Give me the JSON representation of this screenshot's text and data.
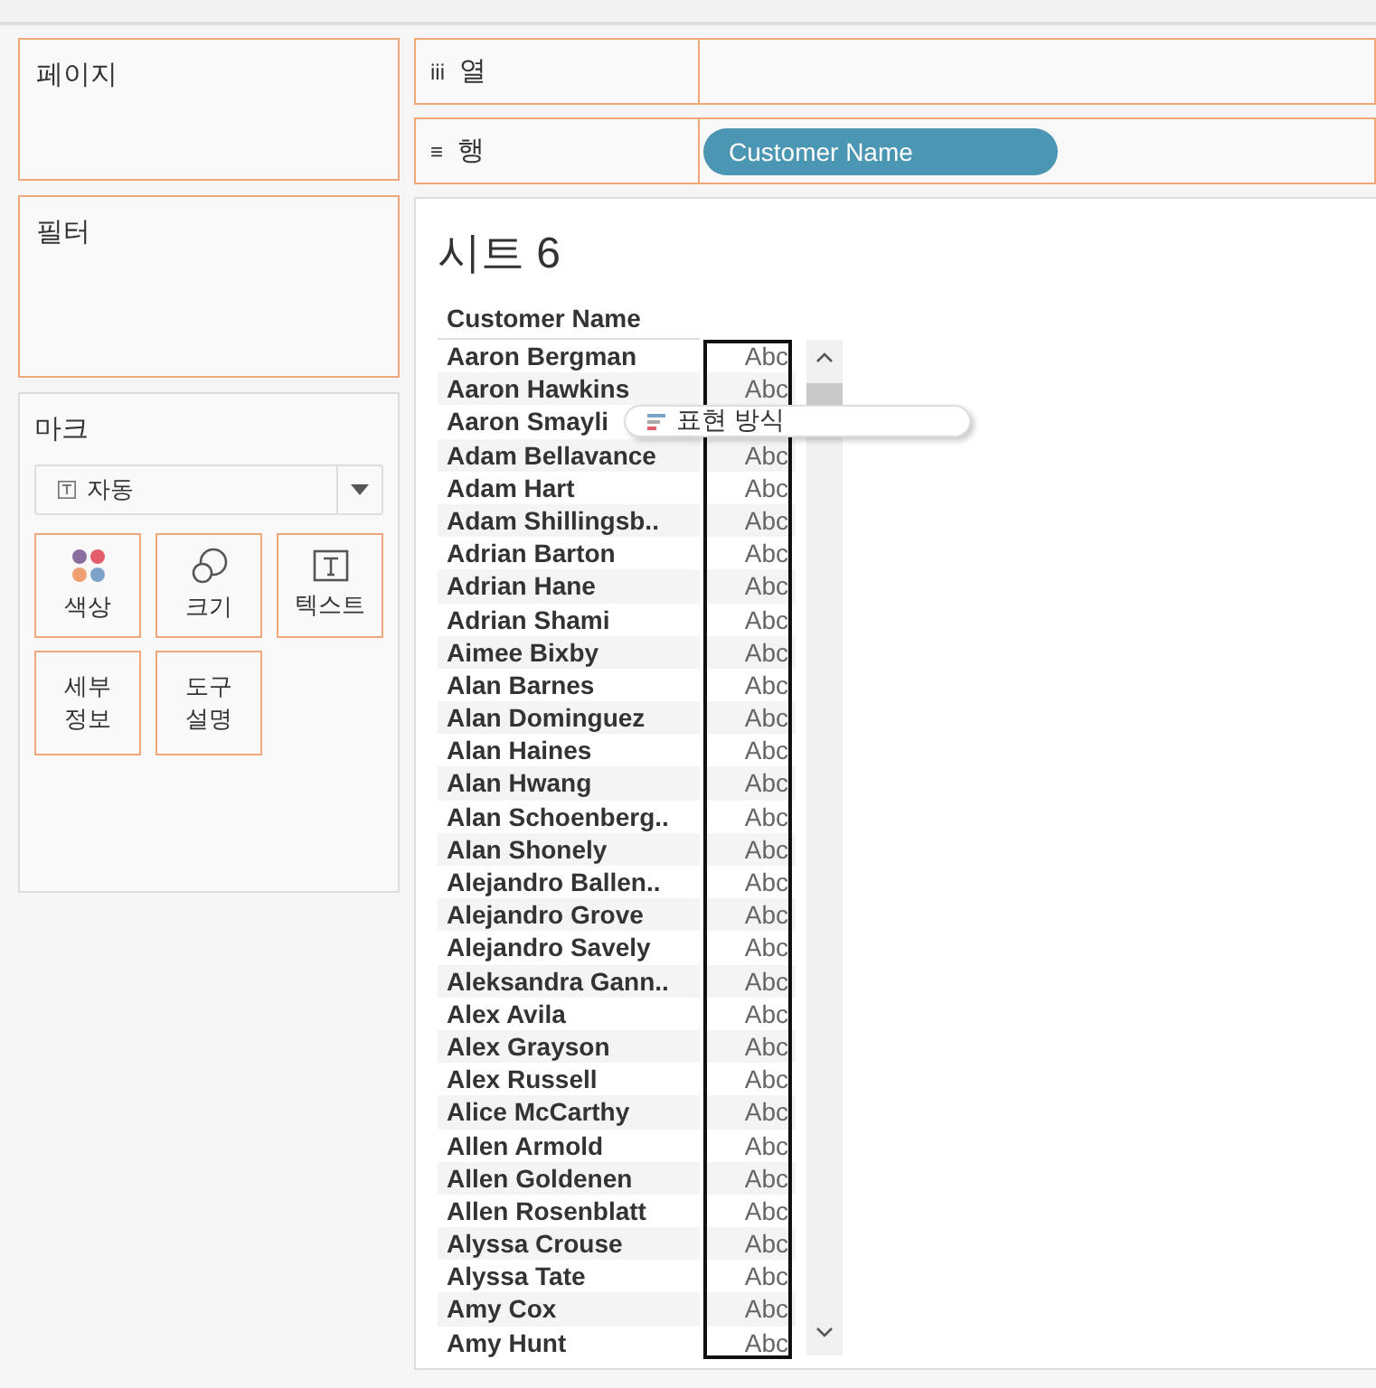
{
  "shelves": {
    "pages": {
      "label": "페이지"
    },
    "columns": {
      "icon": "iii",
      "label": "열"
    },
    "rows": {
      "icon": "≡",
      "label": "행",
      "pills": [
        "Customer Name"
      ]
    }
  },
  "filters": {
    "label": "필터"
  },
  "marks": {
    "label": "마크",
    "mark_type": "자동",
    "cards": [
      {
        "kind": "color",
        "label": "색상"
      },
      {
        "kind": "size",
        "label": "크기"
      },
      {
        "kind": "text",
        "label": "텍스트"
      },
      {
        "kind": "plain",
        "label": "세부\n정보"
      },
      {
        "kind": "plain",
        "label": "도구\n설명"
      }
    ]
  },
  "sheet": {
    "title": "시트 6",
    "column_header": "Customer Name",
    "rows": [
      {
        "name": "Aaron Bergman",
        "value": "Abc"
      },
      {
        "name": "Aaron Hawkins",
        "value": "Abc"
      },
      {
        "name": "Aaron Smayli"
      },
      {
        "name": "Adam Bellavance",
        "value": "Abc"
      },
      {
        "name": "Adam Hart",
        "value": "Abc"
      },
      {
        "name": "Adam Shillingsb..",
        "value": "Abc"
      },
      {
        "name": "Adrian Barton",
        "value": "Abc"
      },
      {
        "name": "Adrian Hane",
        "value": "Abc"
      },
      {
        "name": "Adrian Shami",
        "value": "Abc"
      },
      {
        "name": "Aimee Bixby",
        "value": "Abc"
      },
      {
        "name": "Alan Barnes",
        "value": "Abc"
      },
      {
        "name": "Alan Dominguez",
        "value": "Abc"
      },
      {
        "name": "Alan Haines",
        "value": "Abc"
      },
      {
        "name": "Alan Hwang",
        "value": "Abc"
      },
      {
        "name": "Alan Schoenberg..",
        "value": "Abc"
      },
      {
        "name": "Alan Shonely",
        "value": "Abc"
      },
      {
        "name": "Alejandro Ballen..",
        "value": "Abc"
      },
      {
        "name": "Alejandro Grove",
        "value": "Abc"
      },
      {
        "name": "Alejandro Savely",
        "value": "Abc"
      },
      {
        "name": "Aleksandra Gann..",
        "value": "Abc"
      },
      {
        "name": "Alex Avila",
        "value": "Abc"
      },
      {
        "name": "Alex Grayson",
        "value": "Abc"
      },
      {
        "name": "Alex Russell",
        "value": "Abc"
      },
      {
        "name": "Alice McCarthy",
        "value": "Abc"
      },
      {
        "name": "Allen Armold",
        "value": "Abc"
      },
      {
        "name": "Allen Goldenen",
        "value": "Abc"
      },
      {
        "name": "Allen Rosenblatt",
        "value": "Abc"
      },
      {
        "name": "Alyssa Crouse",
        "value": "Abc"
      },
      {
        "name": "Alyssa Tate",
        "value": "Abc"
      },
      {
        "name": "Amy Cox",
        "value": "Abc"
      },
      {
        "name": "Amy Hunt",
        "value": "Abc"
      }
    ]
  },
  "drag_tooltip": {
    "label": "표현 방식"
  }
}
